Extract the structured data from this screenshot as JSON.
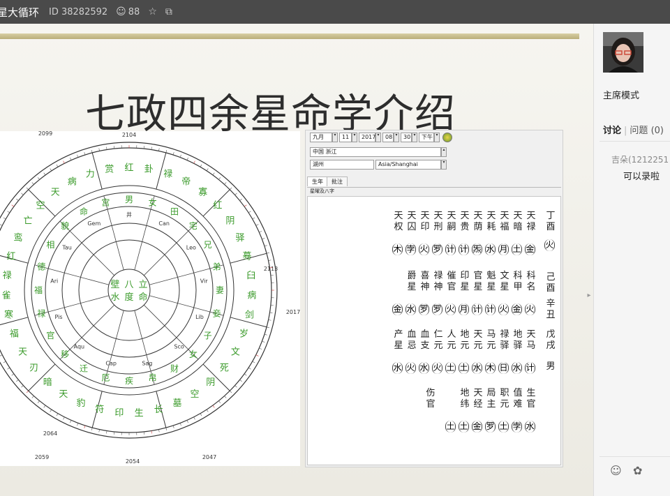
{
  "topbar": {
    "title": "星大循环",
    "room_id": "ID 38282592",
    "viewer_count": "88"
  },
  "slide": {
    "title": "七政四余星命学介绍"
  },
  "chart": {
    "degree_labels": [
      "2104",
      "2113",
      "2017",
      "2099",
      "2064",
      "2059",
      "2054",
      "2047"
    ],
    "outer_ring": [
      "红",
      "卦",
      "禄",
      "帝",
      "寡",
      "红",
      "阴",
      "驿",
      "蓦",
      "臼",
      "病",
      "剑",
      "岁",
      "文",
      "死",
      "阴",
      "空",
      "墓",
      "长",
      "生",
      "印",
      "符",
      "豹",
      "天",
      "暗",
      "刃",
      "天",
      "福",
      "寒",
      "雀",
      "禄",
      "红",
      "鸾",
      "亡",
      "空",
      "天",
      "病",
      "力",
      "赏"
    ],
    "middle_ring": [
      "男",
      "女",
      "田",
      "宅",
      "兄",
      "弟",
      "妻",
      "妾",
      "子",
      "女",
      "财",
      "帛",
      "疾",
      "厄",
      "迁",
      "移",
      "官",
      "禄",
      "福",
      "德",
      "相",
      "貌",
      "命",
      "宫"
    ],
    "inner_ring": [
      "井",
      "Can",
      "Leo",
      "Vir",
      "Lib",
      "Sco",
      "Sag",
      "Cap",
      "Aqu",
      "Pis",
      "Ari",
      "Tau",
      "Gem"
    ],
    "center": [
      "壁",
      "八",
      "立",
      "水",
      "度",
      "命"
    ]
  },
  "app": {
    "date": {
      "month": "九月",
      "day": "11",
      "year": "2017",
      "hour": "08",
      "minute": "30",
      "ampm": "下午"
    },
    "location": {
      "region": "中国 浙江",
      "city": "湖州",
      "timezone": "Asia/Shanghai"
    },
    "tabs": [
      "生年",
      "批注"
    ],
    "subheader": "星曜及八字",
    "pillars": [
      "丁酉",
      "己酉",
      "辛丑",
      "戊戌",
      "男"
    ],
    "pillar_element": "火",
    "rows": [
      {
        "names": [
          "天权",
          "天囚",
          "天印",
          "天刑",
          "天嗣",
          "天贵",
          "天荫",
          "天耗",
          "天福",
          "天暗",
          "天禄"
        ],
        "values": [
          "木",
          "孛",
          "火",
          "罗",
          "计",
          "计",
          "炁",
          "水",
          "月",
          "土",
          "金"
        ]
      },
      {
        "names": [
          "爵星",
          "喜神",
          "禄神",
          "催官",
          "印星",
          "官星",
          "魁星",
          "文星",
          "科甲",
          "科名"
        ],
        "values": [
          "金",
          "水",
          "罗",
          "罗",
          "火",
          "月",
          "计",
          "计",
          "火",
          "金",
          "火"
        ]
      },
      {
        "names": [
          "产星",
          "血忌",
          "血支",
          "仁元",
          "人元",
          "地元",
          "天元",
          "马元",
          "禄驿",
          "地驿",
          "天马"
        ],
        "values": [
          "水",
          "火",
          "水",
          "火",
          "土",
          "土",
          "水",
          "木",
          "日",
          "水",
          "计"
        ]
      },
      {
        "names": [
          "伤官",
          "地纬",
          "天经",
          "局主",
          "职元",
          "值难",
          "生官"
        ],
        "values": [
          "土",
          "土",
          "金",
          "罗",
          "土",
          "孛",
          "水"
        ]
      }
    ]
  },
  "sidebar": {
    "mode": "主席模式",
    "tab_discuss": "讨论",
    "tab_question": "问题",
    "question_count": "(0)",
    "message_name": "吉朵(1212251",
    "message_text": "可以录啦"
  }
}
